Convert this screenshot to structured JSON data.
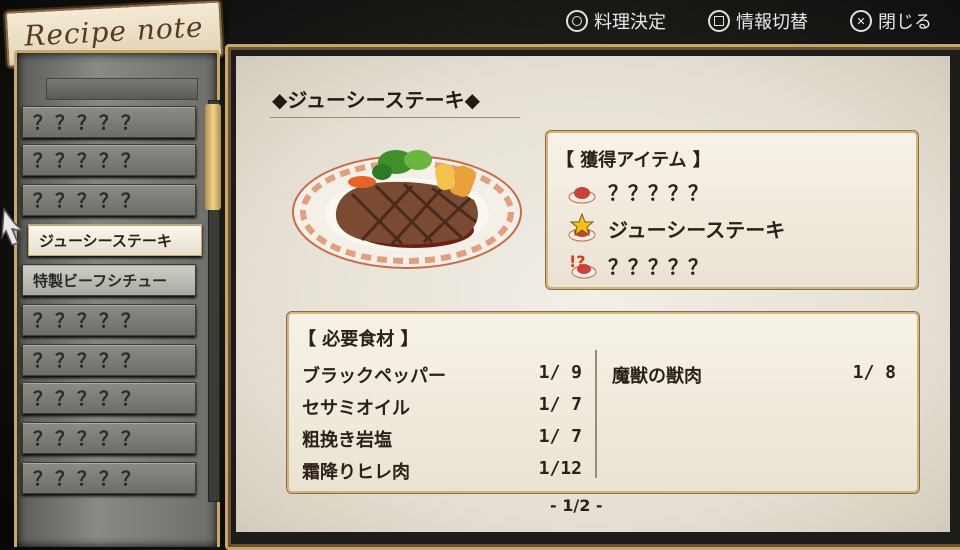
{
  "title_tag": "Recipe note",
  "controls": [
    {
      "icon": "circle-button-icon",
      "label": "料理決定"
    },
    {
      "icon": "square-button-icon",
      "label": "情報切替"
    },
    {
      "icon": "cross-button-icon",
      "label": "閉じる"
    }
  ],
  "recipes": [
    {
      "label": "？？？？？",
      "state": "unknown"
    },
    {
      "label": "？？？？？",
      "state": "unknown"
    },
    {
      "label": "？？？？？",
      "state": "unknown"
    },
    {
      "label": "ジューシーステーキ",
      "state": "selected"
    },
    {
      "label": "特製ビーフシチュー",
      "state": "known"
    },
    {
      "label": "？？？？？",
      "state": "unknown"
    },
    {
      "label": "？？？？？",
      "state": "unknown"
    },
    {
      "label": "？？？？？",
      "state": "unknown"
    },
    {
      "label": "？？？？？",
      "state": "unknown"
    },
    {
      "label": "？？？？？",
      "state": "unknown"
    }
  ],
  "recipe_title": "◆ジューシーステーキ◆",
  "acquired": {
    "header": "【 獲得アイテム 】",
    "items": [
      {
        "icon": "dish-icon",
        "label": "？？？？？"
      },
      {
        "icon": "star-dish-icon",
        "label": "ジューシーステーキ"
      },
      {
        "icon": "surprise-dish-icon",
        "label": "？？？？？"
      }
    ]
  },
  "ingredients": {
    "header": "【 必要食材 】",
    "left": [
      {
        "name": "ブラックペッパー",
        "count": "1/ 9"
      },
      {
        "name": "セサミオイル",
        "count": "1/ 7"
      },
      {
        "name": "粗挽き岩塩",
        "count": "1/ 7"
      },
      {
        "name": "霜降りヒレ肉",
        "count": "1/12"
      }
    ],
    "right": [
      {
        "name": "魔獣の獣肉",
        "count": "1/ 8"
      }
    ]
  },
  "page_indicator": "- 1/2 -",
  "colors": {
    "gold_frame": "#c8a86a",
    "paper": "#efeae0",
    "panel_gray": "#7a7a75"
  }
}
